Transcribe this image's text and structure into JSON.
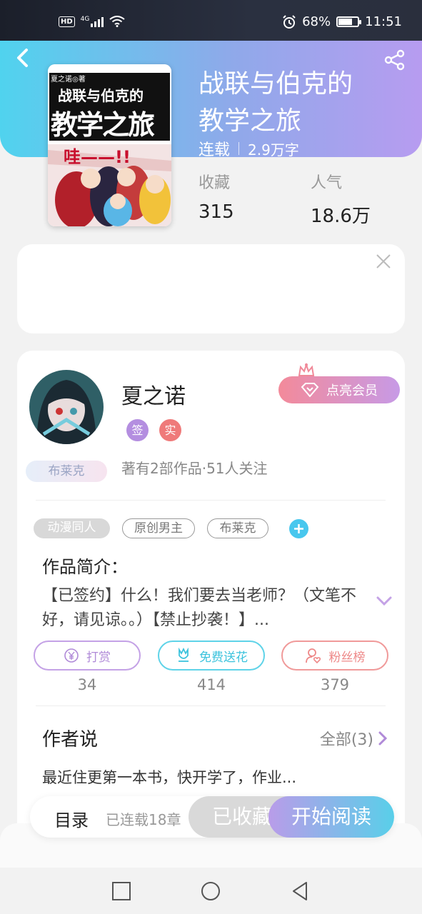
{
  "status_bar": {
    "network": "HD",
    "signal": "4G",
    "battery": "68%",
    "battery_level": 0.68,
    "time": "11:51"
  },
  "book": {
    "title_line1": "战联与伯克的",
    "title_line2": "教学之旅",
    "status": "连载",
    "word_count": "2.9万字",
    "favorites_label": "收藏",
    "favorites": "315",
    "popularity_label": "人气",
    "popularity": "18.6万",
    "cover": {
      "author_mark": "夏之诺◎著",
      "title_top": "战联与伯克的",
      "title_big": "教学之旅",
      "sound": "哇——!!"
    }
  },
  "author": {
    "name": "夏之诺",
    "badge_signed": "签",
    "badge_verified": "实",
    "vip_button": "点亮会员",
    "fan_tag": "布莱克",
    "stats": "著有2部作品·51人关注"
  },
  "tags": [
    "动漫同人",
    "原创男主",
    "布莱克"
  ],
  "intro": {
    "title": "作品简介：",
    "text": "【已签约】什么！我们要去当老师？（文笔不好，请见谅。。）【禁止抄袭！】..."
  },
  "actions": [
    {
      "label": "打赏",
      "count": "34"
    },
    {
      "label": "免费送花",
      "count": "414"
    },
    {
      "label": "粉丝榜",
      "count": "379"
    }
  ],
  "author_says": {
    "title": "作者说",
    "all": "全部(3)",
    "text": "最近住更第一本书，快开学了，作业..."
  },
  "bottom_bar": {
    "toc": "目录",
    "toc_sub": "已连载18章",
    "favorite": "已收藏",
    "read": "开始阅读"
  },
  "colors": {
    "header_start": "#50d3ee",
    "header_end": "#b79cf0",
    "accent_blue": "#48c7ee",
    "vip_pink": "#f38a9a"
  }
}
